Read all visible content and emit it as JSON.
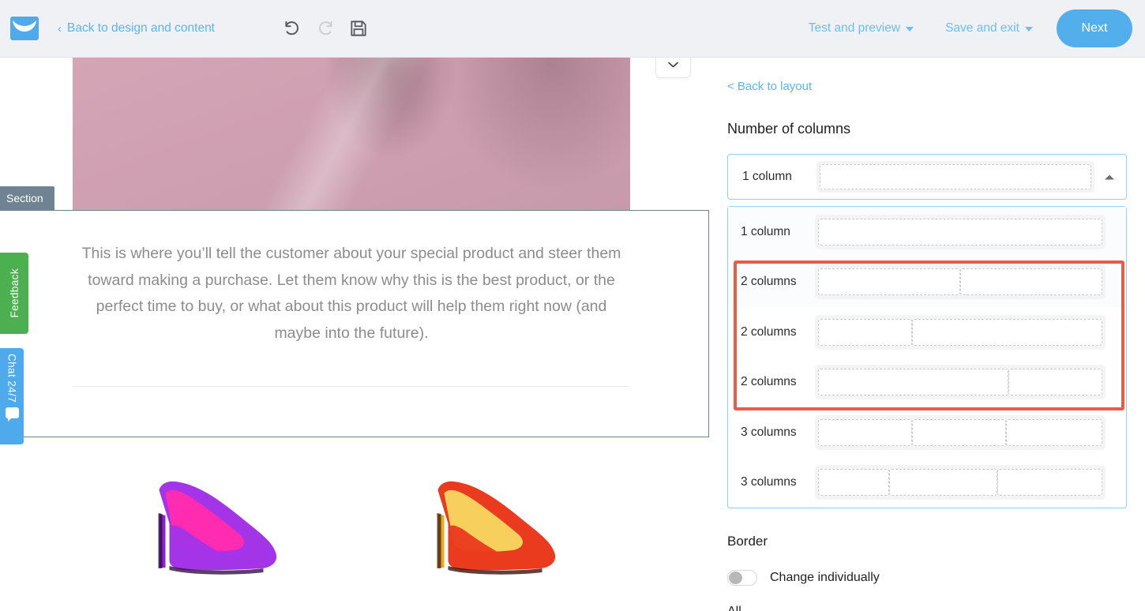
{
  "topbar": {
    "logo_icon": "mailchimp-envelope-logo",
    "back_link": "Back to design and content",
    "back_chevron": "‹",
    "undo_icon": "undo-icon",
    "redo_icon": "redo-icon",
    "save_icon": "save-disk-icon",
    "test_preview": "Test and preview",
    "save_exit": "Save and exit",
    "next": "Next",
    "accent": "#53aeec",
    "link_color": "#5bb4ef",
    "bg": "#f0f1f4"
  },
  "canvas": {
    "section_tab_label": "Section",
    "section_tab_color": "#6f8393",
    "collapse_icon": "chevron-down-icon",
    "hero_image_alt": "pink-fabric-hero-image",
    "body_text": "This is where you’ll tell the customer about your special product and steer them toward making a purchase. Let them know why this is the best product, or the perfect time to buy, or what about this product will help them right now (and maybe into the future).",
    "products": [
      {
        "name": "purple-high-heel-shoe",
        "outer": "#a334e8",
        "inner": "#ff2bb0",
        "accent": "#8f1fd6"
      },
      {
        "name": "red-high-heel-shoe",
        "outer": "#ea3b1e",
        "inner": "#f6cf5c",
        "accent": "#d6331a"
      }
    ]
  },
  "side_tabs": {
    "feedback": {
      "label": "Feedback",
      "color": "#4caf50"
    },
    "chat": {
      "label": "Chat 24/7",
      "color": "#4eaaea",
      "icon": "chat-bubble-icon"
    }
  },
  "panel": {
    "back_to_layout": "< Back to layout",
    "title": "Number of columns",
    "selected": {
      "label": "1 column",
      "caret_icon": "caret-up-icon",
      "widths": [
        100
      ]
    },
    "options": [
      {
        "label": "1 column",
        "widths": [
          100
        ]
      },
      {
        "label": "2 columns",
        "widths": [
          50,
          50
        ]
      },
      {
        "label": "2 columns",
        "widths": [
          33,
          67
        ]
      },
      {
        "label": "2 columns",
        "widths": [
          67,
          33
        ]
      },
      {
        "label": "3 columns",
        "widths": [
          33,
          33,
          34
        ]
      },
      {
        "label": "3 columns",
        "widths": [
          25,
          38,
          37
        ]
      }
    ],
    "highlight": {
      "color": "#ea5c47",
      "covers_options": [
        1,
        2,
        3
      ]
    },
    "border_title": "Border",
    "toggle_label": "Change individually",
    "toggle_on": false,
    "all_label": "All"
  }
}
